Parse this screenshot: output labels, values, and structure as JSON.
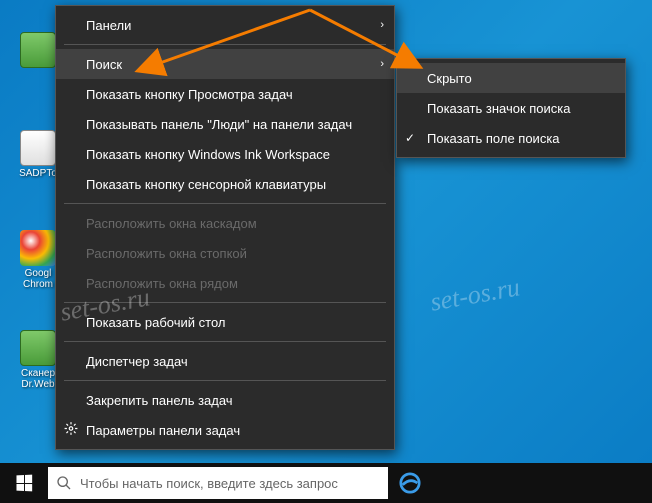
{
  "desktop": {
    "icons": [
      {
        "label": ""
      },
      {
        "label": "SADPTo"
      },
      {
        "label": "Googl\nChrom"
      },
      {
        "label": "Сканер\nDr.Web"
      }
    ]
  },
  "taskbar": {
    "search_placeholder": "Чтобы начать поиск, введите здесь запрос"
  },
  "context_menu": {
    "items": [
      {
        "label": "Панели",
        "submenu": true
      },
      {
        "sep": true
      },
      {
        "label": "Поиск",
        "submenu": true,
        "highlighted": true
      },
      {
        "label": "Показать кнопку Просмотра задач"
      },
      {
        "label": "Показывать панель \"Люди\" на панели задач"
      },
      {
        "label": "Показать кнопку Windows Ink Workspace"
      },
      {
        "label": "Показать кнопку сенсорной клавиатуры"
      },
      {
        "sep": true
      },
      {
        "label": "Расположить окна каскадом",
        "disabled": true
      },
      {
        "label": "Расположить окна стопкой",
        "disabled": true
      },
      {
        "label": "Расположить окна рядом",
        "disabled": true
      },
      {
        "sep": true
      },
      {
        "label": "Показать рабочий стол"
      },
      {
        "sep": true
      },
      {
        "label": "Диспетчер задач"
      },
      {
        "sep": true
      },
      {
        "label": "Закрепить панель задач"
      },
      {
        "label": "Параметры панели задач",
        "icon": "gear"
      }
    ]
  },
  "sub_menu": {
    "items": [
      {
        "label": "Скрыто",
        "highlighted": true
      },
      {
        "label": "Показать значок поиска"
      },
      {
        "label": "Показать поле поиска",
        "checked": true
      }
    ]
  },
  "watermark": "set-os.ru",
  "annotation": {
    "arrow_color": "#f57c00"
  }
}
